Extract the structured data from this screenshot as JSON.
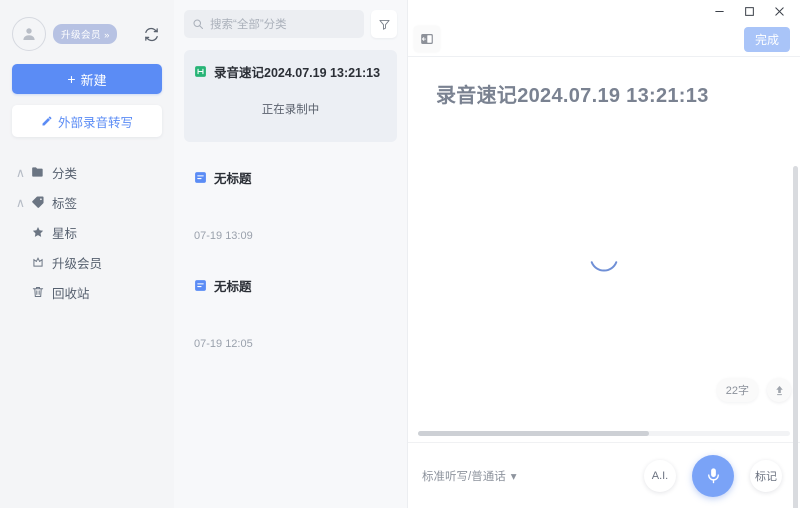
{
  "sidebar": {
    "account": {
      "avatar_icon": "user-avatar-icon",
      "vip_label": "升级会员 »",
      "sync_icon": "sync-refresh-icon"
    },
    "new_button": {
      "plus": "+",
      "label": "新建"
    },
    "external_button": {
      "icon": "pencil-icon",
      "label": "外部录音转写"
    },
    "nav_items": [
      {
        "label": "分类",
        "icon": "folder-icon",
        "caret": "∧",
        "has_caret": true
      },
      {
        "label": "标签",
        "icon": "tag-icon",
        "caret": "∧",
        "has_caret": true
      },
      {
        "label": "星标",
        "icon": "star-icon",
        "caret": "",
        "has_caret": false
      },
      {
        "label": "升级会员",
        "icon": "crown-icon",
        "caret": "",
        "has_caret": false
      },
      {
        "label": "回收站",
        "icon": "trash-icon",
        "caret": "",
        "has_caret": false
      }
    ]
  },
  "list_panel": {
    "search": {
      "placeholder": "搜索“全部”分类",
      "value": "",
      "icon": "search-icon"
    },
    "filter_icon": "filter-funnel-icon",
    "notes": [
      {
        "title": "录音速记2024.07.19 13:21:13",
        "status": "正在录制中",
        "time": "",
        "icon": "recording-note-icon",
        "selected": true
      },
      {
        "title": "无标题",
        "status": "",
        "time": "07-19 13:09",
        "icon": "document-note-icon",
        "selected": false
      },
      {
        "title": "无标题",
        "status": "",
        "time": "07-19 12:05",
        "icon": "document-note-icon",
        "selected": false
      }
    ]
  },
  "editor": {
    "window_controls": {
      "minimize": "—",
      "maximize": "□",
      "close": "✕"
    },
    "collapse_icon": "collapse-panel-icon",
    "done_label": "完成",
    "doc_title": "录音速记2024.07.19 13:21:13",
    "loading_icon": "loading-spinner-icon",
    "word_count": "22字",
    "upload_icon": "upload-arrow-icon",
    "bottom_bar": {
      "mode_label": "标准听写/普通话",
      "mode_caret": "▾",
      "ai_label": "A.I.",
      "mic_icon": "microphone-icon",
      "mark_label": "标记"
    }
  },
  "colors": {
    "accent_blue": "#5b8cf5",
    "mic_blue": "#7aa3f7",
    "done_blue": "#a9c4f8",
    "recording_green": "#27b476",
    "note_blue": "#5b8cf5",
    "sidebar_bg": "#f4f5f7",
    "list_bg": "#f7f8fa"
  }
}
